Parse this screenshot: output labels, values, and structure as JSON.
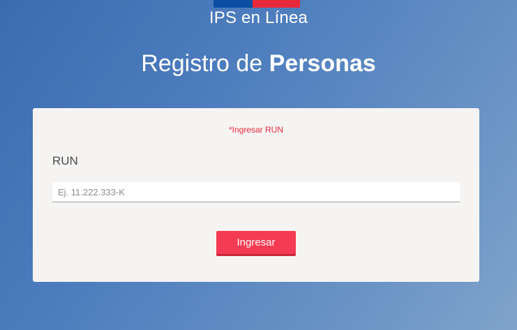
{
  "header": {
    "brand": "IPS en Línea",
    "title_light": "Registro de ",
    "title_bold": "Personas"
  },
  "form": {
    "error": "*Ingresar RUN",
    "run_label": "RUN",
    "run_value": "",
    "run_placeholder": "Ej. 11.222.333-K",
    "submit_label": "Ingresar"
  },
  "colors": {
    "flag_blue": "#0a4fa3",
    "flag_red": "#e8293b",
    "button": "#f43b53",
    "error_text": "#e8293b"
  }
}
